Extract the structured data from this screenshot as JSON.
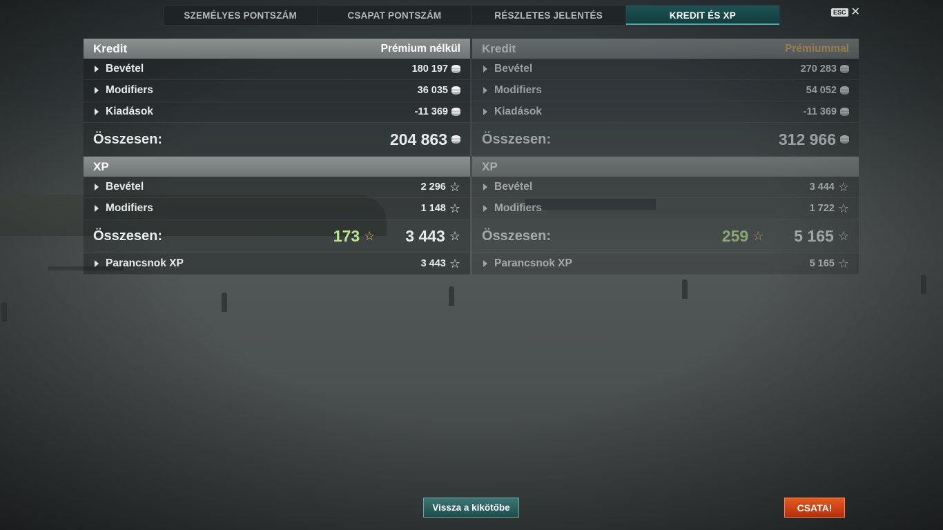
{
  "tabs": [
    {
      "label": "SZEMÉLYES PONTSZÁM"
    },
    {
      "label": "CSAPAT PONTSZÁM"
    },
    {
      "label": "RÉSZLETES JELENTÉS"
    },
    {
      "label": "KREDIT ÉS XP",
      "active": true
    }
  ],
  "esc": {
    "key_label": "ESC",
    "close_glyph": "✕"
  },
  "left": {
    "credit_header": "Kredit",
    "credit_header_sub": "Prémium nélkül",
    "credit_rows": [
      {
        "label": "Bevétel",
        "value": "180 197"
      },
      {
        "label": "Modifiers",
        "value": "36 035"
      },
      {
        "label": "Kiadások",
        "value": "-11 369"
      }
    ],
    "credit_total_label": "Összesen:",
    "credit_total_value": "204 863",
    "xp_header": "XP",
    "xp_rows": [
      {
        "label": "Bevétel",
        "value": "2 296"
      },
      {
        "label": "Modifiers",
        "value": "1 148"
      }
    ],
    "xp_total_label": "Összesen:",
    "xp_total_bonus": "173",
    "xp_total_value": "3 443",
    "commander_label": "Parancsnok XP",
    "commander_value": "3 443"
  },
  "right": {
    "credit_header": "Kredit",
    "credit_header_sub": "Prémiummal",
    "credit_rows": [
      {
        "label": "Bevétel",
        "value": "270 283"
      },
      {
        "label": "Modifiers",
        "value": "54 052"
      },
      {
        "label": "Kiadások",
        "value": "-11 369"
      }
    ],
    "credit_total_label": "Összesen:",
    "credit_total_value": "312 966",
    "xp_header": "XP",
    "xp_rows": [
      {
        "label": "Bevétel",
        "value": "3 444"
      },
      {
        "label": "Modifiers",
        "value": "1 722"
      }
    ],
    "xp_total_label": "Összesen:",
    "xp_total_bonus": "259",
    "xp_total_value": "5 165",
    "commander_label": "Parancsnok XP",
    "commander_value": "5 165"
  },
  "buttons": {
    "back": "Vissza a kikötőbe",
    "battle": "CSATA!"
  },
  "icons": {
    "credit": "credit-coin-icon",
    "xp": "star-icon"
  },
  "colors": {
    "active_tab": "#1c5252",
    "battle_button": "#d9441a",
    "bonus_xp": "#bde88a",
    "premium_gold": "#f0bf63"
  }
}
